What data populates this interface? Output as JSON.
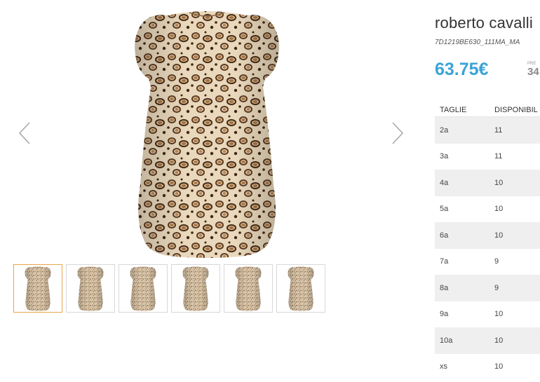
{
  "product": {
    "brand": "roberto cavalli",
    "sku": "7D1219BE630_111MA_MA",
    "price": "63.75€",
    "old_price_label": "PRE",
    "old_price": "34"
  },
  "gallery": {
    "thumbnail_count": 6,
    "active_thumbnail": 1,
    "prev_icon": "chevron-left-icon",
    "next_icon": "chevron-right-icon"
  },
  "sizes_table": {
    "headers": [
      "TAGLIE",
      "DISPONIBIL"
    ],
    "rows": [
      {
        "size": "2a",
        "qty": "11"
      },
      {
        "size": "3a",
        "qty": "11"
      },
      {
        "size": "4a",
        "qty": "10"
      },
      {
        "size": "5a",
        "qty": "10"
      },
      {
        "size": "6a",
        "qty": "10"
      },
      {
        "size": "7a",
        "qty": "9"
      },
      {
        "size": "8a",
        "qty": "9"
      },
      {
        "size": "9a",
        "qty": "10"
      },
      {
        "size": "10a",
        "qty": "10"
      },
      {
        "size": "xs",
        "qty": "10"
      }
    ]
  },
  "colors": {
    "price": "#3aa3d9",
    "active_thumb_border": "#e8a44a",
    "row_shade": "#efefef",
    "dress_base": "#e8d6b8",
    "dress_spot": "#6b4a2b"
  }
}
